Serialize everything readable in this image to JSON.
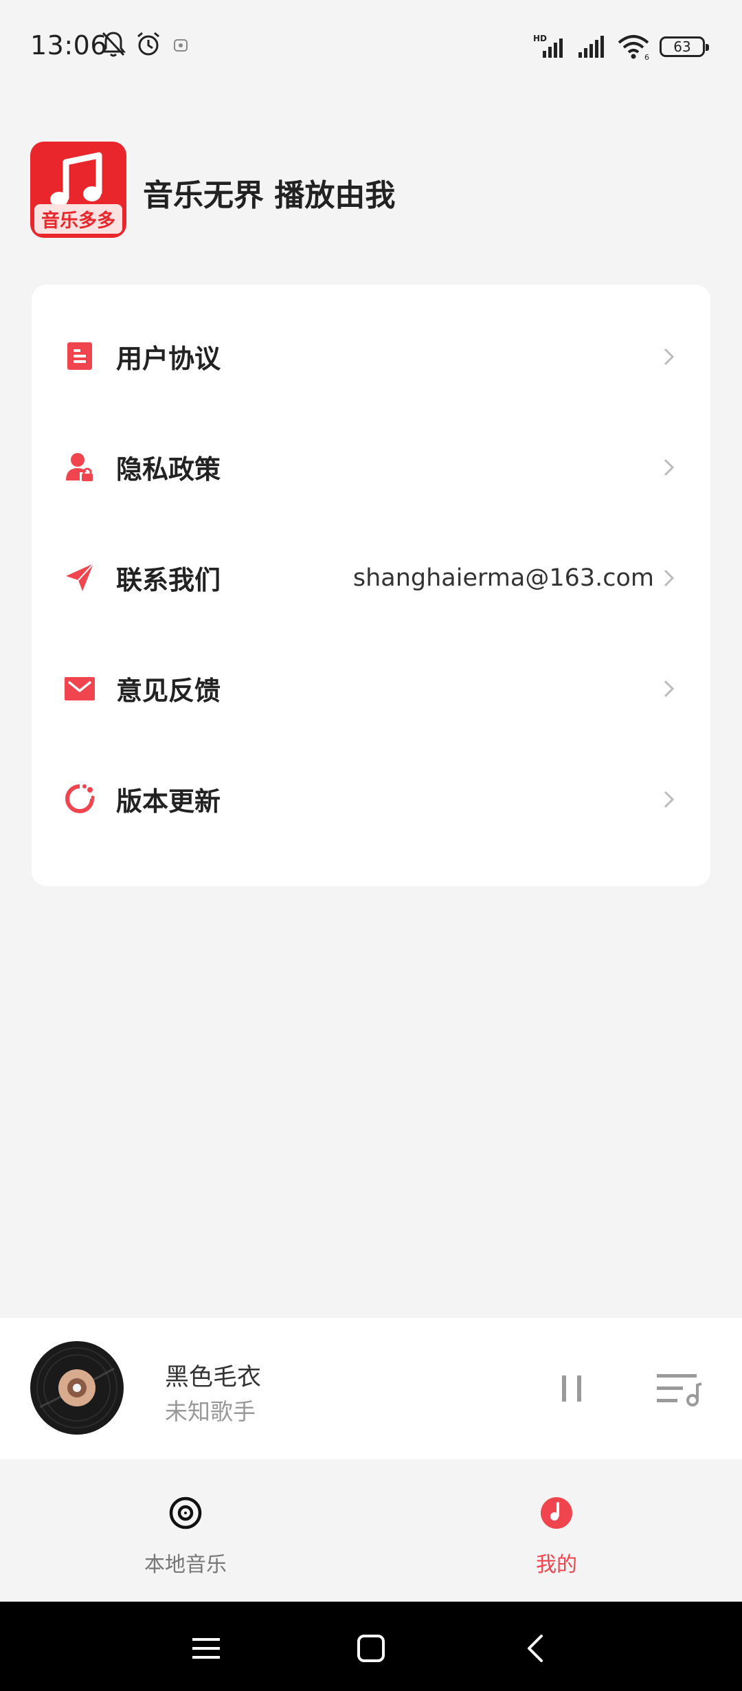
{
  "status_bar": {
    "time": "13:06",
    "icons": [
      "bell-off-icon",
      "alarm-icon",
      "notification-icon",
      "hd-signal-icon",
      "signal-icon",
      "wifi-icon"
    ],
    "battery": "63"
  },
  "header": {
    "logo_text": "音乐多多",
    "slogan": "音乐无界 播放由我"
  },
  "menu": {
    "items": [
      {
        "label": "用户协议",
        "icon": "document-icon",
        "value": ""
      },
      {
        "label": "隐私政策",
        "icon": "privacy-user-icon",
        "value": ""
      },
      {
        "label": "联系我们",
        "icon": "send-icon",
        "value": "shanghaierma@163.com"
      },
      {
        "label": "意见反馈",
        "icon": "mail-icon",
        "value": ""
      },
      {
        "label": "版本更新",
        "icon": "refresh-icon",
        "value": ""
      }
    ]
  },
  "now_playing": {
    "title": "黑色毛衣",
    "artist": "未知歌手"
  },
  "tabs": [
    {
      "label": "本地音乐",
      "icon": "disc-icon",
      "active": false
    },
    {
      "label": "我的",
      "icon": "profile-icon",
      "active": true
    }
  ],
  "colors": {
    "accent": "#f0454f",
    "brand": "#e8262b",
    "text": "#222222",
    "secondary_text": "#999999",
    "background": "#f4f4f4"
  }
}
